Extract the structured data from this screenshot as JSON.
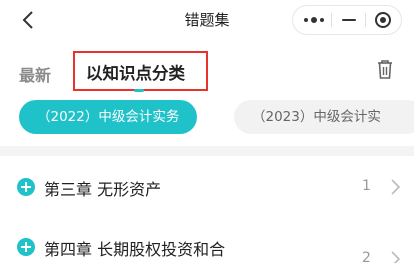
{
  "header": {
    "title": "错题集",
    "back_icon": "chevron-left-icon",
    "capsule": {
      "more_icon": "more-dots-icon",
      "minimize_icon": "minimize-icon",
      "close_icon": "target-close-icon"
    }
  },
  "tabs": {
    "items": [
      {
        "label": "最新",
        "active": false
      },
      {
        "label": "以知识点分类",
        "active": true
      }
    ],
    "highlight_color": "#e8332b",
    "delete_icon": "trash-icon"
  },
  "filters": {
    "chips": [
      {
        "label": "（2022）中级会计实务",
        "selected": true
      },
      {
        "label": "（2023）中级会计实",
        "selected": false
      }
    ],
    "accent_color": "#1fc2c9"
  },
  "chapters": [
    {
      "title": "第三章 无形资产",
      "count": "1"
    },
    {
      "title": "第四章 长期股权投资和合",
      "count": "2"
    }
  ]
}
